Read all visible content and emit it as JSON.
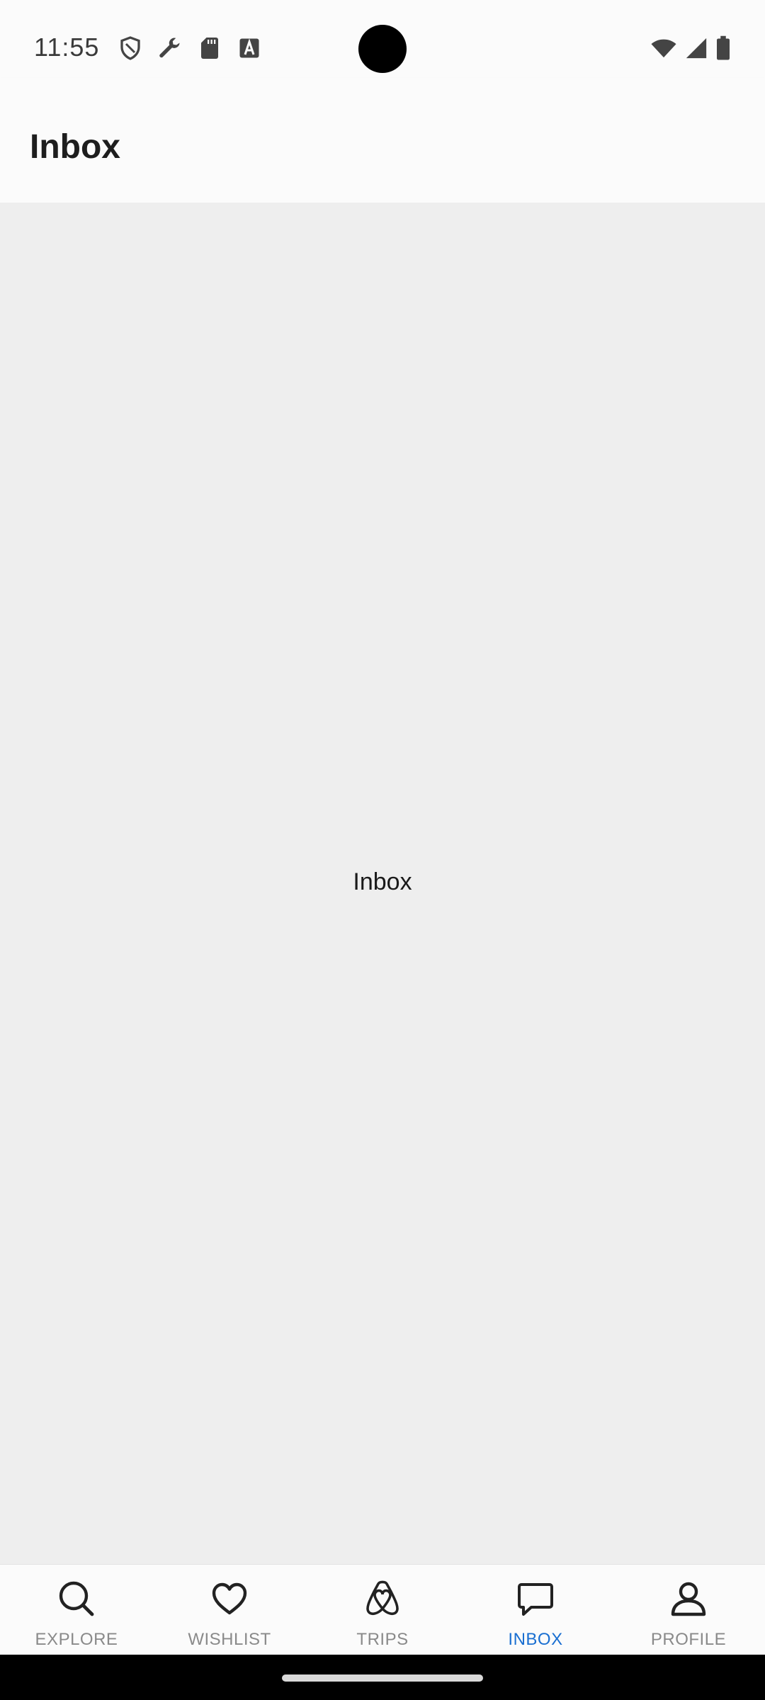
{
  "status_bar": {
    "time": "11:55",
    "left_icons": [
      "shield-icon",
      "wrench-icon",
      "sd-card-icon",
      "a-box-icon"
    ],
    "right_icons": [
      "wifi-icon",
      "signal-icon",
      "battery-icon"
    ]
  },
  "header": {
    "title": "Inbox"
  },
  "main": {
    "placeholder": "Inbox"
  },
  "bottom_nav": {
    "accent_color": "#1a6fd1",
    "inactive_color": "#8a8a8a",
    "items": [
      {
        "label": "EXPLORE",
        "icon": "search-icon",
        "active": false
      },
      {
        "label": "WISHLIST",
        "icon": "heart-icon",
        "active": false
      },
      {
        "label": "TRIPS",
        "icon": "airbnb-logo-icon",
        "active": false
      },
      {
        "label": "INBOX",
        "icon": "chat-bubble-icon",
        "active": true
      },
      {
        "label": "PROFILE",
        "icon": "person-icon",
        "active": false
      }
    ]
  }
}
